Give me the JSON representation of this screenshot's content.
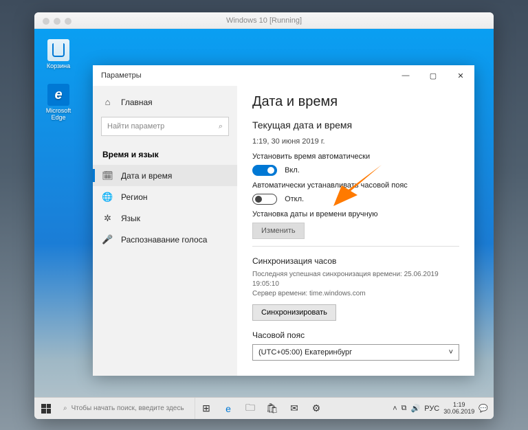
{
  "vm": {
    "title": "Windows 10 [Running]"
  },
  "desktop": {
    "icons": {
      "recycle": "Корзина",
      "edge": "Microsoft Edge"
    }
  },
  "settings": {
    "window_title": "Параметры",
    "sidebar": {
      "home": "Главная",
      "search_placeholder": "Найти параметр",
      "section": "Время и язык",
      "items": [
        {
          "label": "Дата и время"
        },
        {
          "label": "Регион"
        },
        {
          "label": "Язык"
        },
        {
          "label": "Распознавание голоса"
        }
      ]
    },
    "content": {
      "h1": "Дата и время",
      "h2": "Текущая дата и время",
      "current": "1:19, 30 июня 2019 г.",
      "auto_time_label": "Установить время автоматически",
      "auto_time_state": "Вкл.",
      "auto_tz_label": "Автоматически устанавливать часовой пояс",
      "auto_tz_state": "Откл.",
      "manual_label": "Установка даты и времени вручную",
      "manual_btn": "Изменить",
      "sync_title": "Синхронизация часов",
      "sync_last": "Последняя успешная синхронизация времени: 25.06.2019 19:05:10",
      "sync_server": "Сервер времени: time.windows.com",
      "sync_btn": "Синхронизировать",
      "tz_title": "Часовой пояс",
      "tz_value": "(UTC+05:00) Екатеринбург"
    }
  },
  "taskbar": {
    "search_placeholder": "Чтобы начать поиск, введите здесь",
    "lang": "РУС",
    "time": "1:19",
    "date": "30.06.2019"
  }
}
